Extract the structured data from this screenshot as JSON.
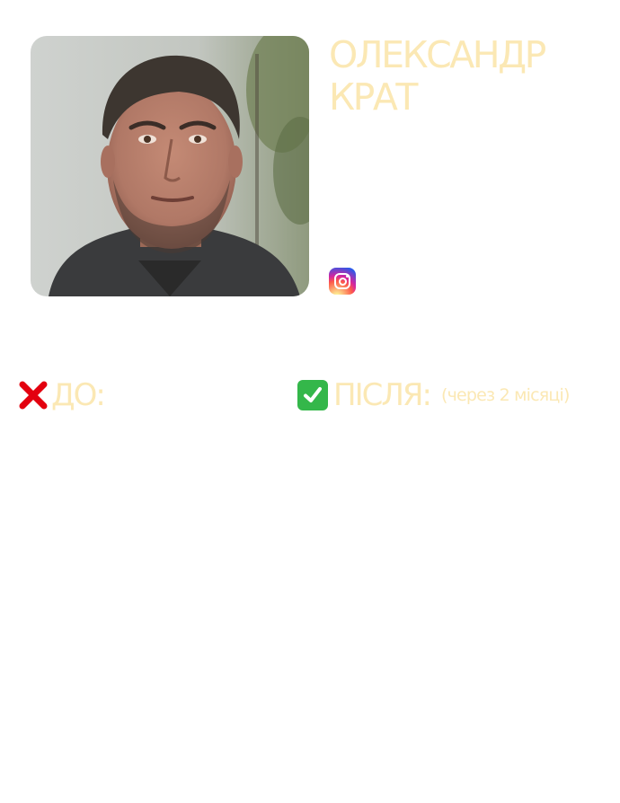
{
  "profile": {
    "first_name": "ОЛЕКСАНДР",
    "last_name": "КРАТ",
    "photo_alt": "portrait-photo",
    "social_icon": "instagram-icon"
  },
  "before": {
    "icon": "cross-mark-icon",
    "label": "ДО:"
  },
  "after": {
    "icon": "check-mark-button-icon",
    "label": "ПІСЛЯ:",
    "note": "(через 2 місяці)"
  },
  "colors": {
    "title": "#fbe8b4",
    "cross": "#e3000f",
    "check": "#34b74a",
    "background": "#ffffff"
  }
}
